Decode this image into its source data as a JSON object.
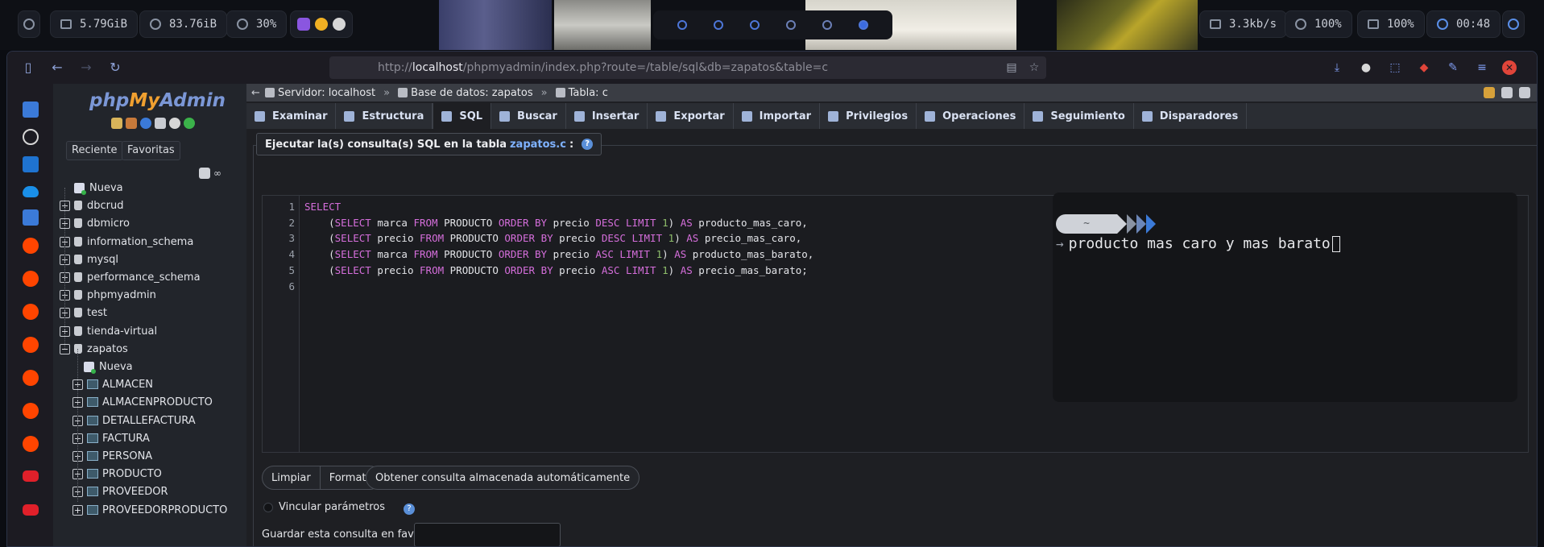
{
  "topbar": {
    "mem": "5.79GiB",
    "disk": "83.76iB",
    "cpu": "30%",
    "net": "3.3kb/s",
    "volume": "100%",
    "battery": "100%",
    "clock": "00:48"
  },
  "browser": {
    "url_prefix": "http://",
    "url_host": "localhost",
    "url_path": "/phpmyadmin/index.php?route=/table/sql&db=zapatos&table=c"
  },
  "pma": {
    "logo_php": "php",
    "logo_my": "My",
    "logo_admin": "Admin",
    "recent": "Reciente",
    "favorites": "Favoritas",
    "tree": [
      {
        "label": "Nueva",
        "kind": "new"
      },
      {
        "label": "dbcrud",
        "kind": "db"
      },
      {
        "label": "dbmicro",
        "kind": "db"
      },
      {
        "label": "information_schema",
        "kind": "db"
      },
      {
        "label": "mysql",
        "kind": "db"
      },
      {
        "label": "performance_schema",
        "kind": "db"
      },
      {
        "label": "phpmyadmin",
        "kind": "db"
      },
      {
        "label": "test",
        "kind": "db"
      },
      {
        "label": "tienda-virtual",
        "kind": "db"
      },
      {
        "label": "zapatos",
        "kind": "db-open"
      },
      {
        "label": "Nueva",
        "kind": "new-sub"
      },
      {
        "label": "ALMACEN",
        "kind": "table"
      },
      {
        "label": "ALMACENPRODUCTO",
        "kind": "table"
      },
      {
        "label": "DETALLEFACTURA",
        "kind": "table"
      },
      {
        "label": "FACTURA",
        "kind": "table"
      },
      {
        "label": "PERSONA",
        "kind": "table"
      },
      {
        "label": "PRODUCTO",
        "kind": "table"
      },
      {
        "label": "PROVEEDOR",
        "kind": "table"
      },
      {
        "label": "PROVEEDORPRODUCTO",
        "kind": "table"
      }
    ]
  },
  "breadcrumb": {
    "server": "Servidor: localhost",
    "database": "Base de datos: zapatos",
    "table": "Tabla: c",
    "sep": "»"
  },
  "tabs": [
    "Examinar",
    "Estructura",
    "SQL",
    "Buscar",
    "Insertar",
    "Exportar",
    "Importar",
    "Privilegios",
    "Operaciones",
    "Seguimiento",
    "Disparadores"
  ],
  "sql": {
    "legend_prefix": "Ejecutar la(s) consulta(s) SQL en la tabla",
    "legend_table": "zapatos.c",
    "legend_suffix": ":",
    "line_numbers": [
      "1",
      "2",
      "3",
      "4",
      "5",
      "6"
    ],
    "lines": [
      "SELECT",
      "    (SELECT marca FROM PRODUCTO ORDER BY precio DESC LIMIT 1) AS producto_mas_caro,",
      "    (SELECT precio FROM PRODUCTO ORDER BY precio DESC LIMIT 1) AS precio_mas_caro,",
      "    (SELECT marca FROM PRODUCTO ORDER BY precio ASC LIMIT 1) AS producto_mas_barato,",
      "    (SELECT precio FROM PRODUCTO ORDER BY precio ASC LIMIT 1) AS precio_mas_barato;",
      ""
    ],
    "btn_clear": "Limpiar",
    "btn_format": "Formato",
    "btn_saved": "Obtener consulta almacenada automáticamente",
    "bind_params": "Vincular parámetros",
    "bookmark_label": "Guardar esta consulta en favoritos:"
  },
  "terminal": {
    "dir": "~",
    "command": "producto mas caro y mas barato"
  }
}
